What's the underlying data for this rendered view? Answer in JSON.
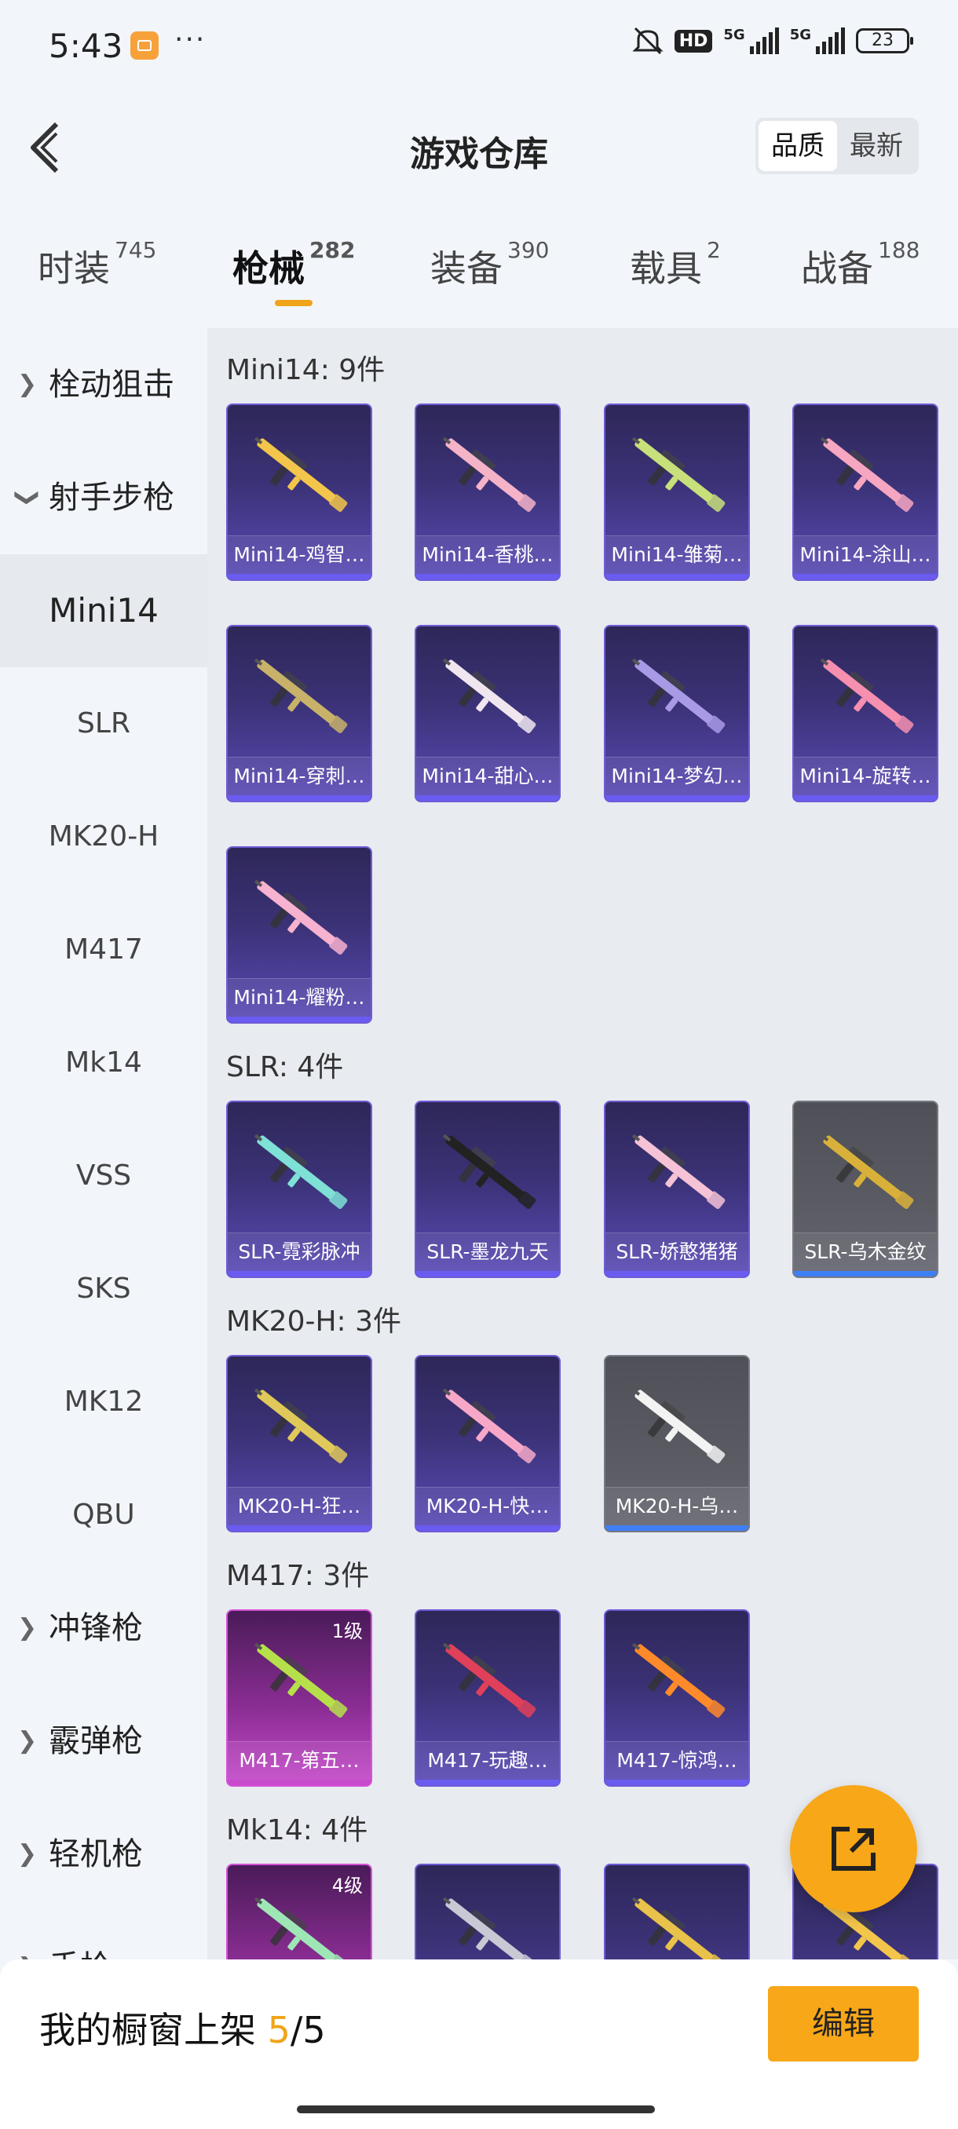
{
  "status_bar": {
    "time": "5:43",
    "battery": "23",
    "hd_label": "HD",
    "net1": "5G",
    "net2": "5G"
  },
  "header": {
    "title": "游戏仓库",
    "sort_quality": "品质",
    "sort_latest": "最新"
  },
  "tabs": [
    {
      "label": "时装",
      "count": "745"
    },
    {
      "label": "枪械",
      "count": "282"
    },
    {
      "label": "装备",
      "count": "390"
    },
    {
      "label": "载具",
      "count": "2"
    },
    {
      "label": "战备",
      "count": "188"
    }
  ],
  "sidebar": [
    {
      "label": "栓动狙击"
    },
    {
      "label": "射手步枪"
    },
    {
      "label": "Mini14"
    },
    {
      "label": "SLR"
    },
    {
      "label": "MK20-H"
    },
    {
      "label": "M417"
    },
    {
      "label": "Mk14"
    },
    {
      "label": "VSS"
    },
    {
      "label": "SKS"
    },
    {
      "label": "MK12"
    },
    {
      "label": "QBU"
    },
    {
      "label": "冲锋枪"
    },
    {
      "label": "霰弹枪"
    },
    {
      "label": "轻机枪"
    },
    {
      "label": "手枪"
    }
  ],
  "sections": [
    {
      "title": "Mini14: 9件",
      "items": [
        "Mini14-鸡智…",
        "Mini14-香桃…",
        "Mini14-雏菊…",
        "Mini14-涂山…",
        "Mini14-穿刺…",
        "Mini14-甜心…",
        "Mini14-梦幻…",
        "Mini14-旋转…",
        "Mini14-耀粉…"
      ]
    },
    {
      "title": "SLR: 4件",
      "items": [
        "SLR-霓彩脉冲",
        "SLR-墨龙九天",
        "SLR-娇憨猪猪",
        "SLR-乌木金纹"
      ]
    },
    {
      "title": "MK20-H: 3件",
      "items": [
        "MK20-H-狂…",
        "MK20-H-快…",
        "MK20-H-乌…"
      ]
    },
    {
      "title": "M417: 3件",
      "items": [
        "M417-第五…",
        "M417-玩趣…",
        "M417-惊鸿…"
      ],
      "level": "1级"
    },
    {
      "title": "Mk14: 4件",
      "items": [
        "",
        "",
        "",
        ""
      ],
      "level": "4级"
    }
  ],
  "footer": {
    "label": "我的橱窗上架",
    "current": "5",
    "sep": "/",
    "total": "5",
    "edit": "编辑"
  },
  "colors": {
    "accent": "#f7a717",
    "card_purple": "#3b3277",
    "card_grey": "#5a5b63",
    "card_pink": "#c64acb"
  }
}
